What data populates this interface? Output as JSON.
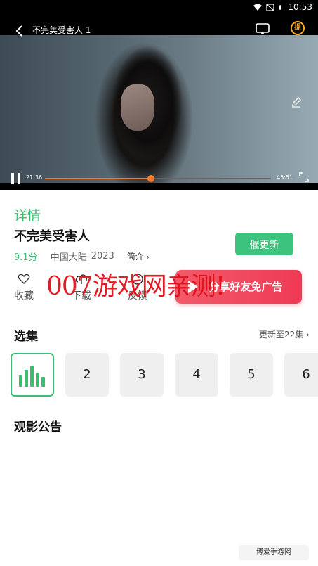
{
  "status": {
    "time": "10:53"
  },
  "player": {
    "title": "不完美受害人 1",
    "elapsed": "21:36",
    "duration": "45:51",
    "progress": 0.47,
    "coin_label": "提"
  },
  "details": {
    "tab_label": "详情",
    "title": "不完美受害人",
    "score": "9.1分",
    "region": "中国大陆",
    "year": "2023",
    "intro_label": "简介",
    "update_button": "催更新"
  },
  "actions": {
    "favorite": "收藏",
    "download": "下载",
    "feedback": "反馈",
    "ad_button": "分享好友免广告"
  },
  "watermark": "007游戏网亲测!",
  "episodes": {
    "heading": "选集",
    "more_label": "更新至22集",
    "items": [
      "2",
      "3",
      "4",
      "5",
      "6"
    ]
  },
  "notice": {
    "heading": "观影公告"
  },
  "logo_watermark": "博爱手游网",
  "colors": {
    "accent": "#3dbd72",
    "progress": "#f07b2e",
    "ad": "#ef3a55"
  }
}
